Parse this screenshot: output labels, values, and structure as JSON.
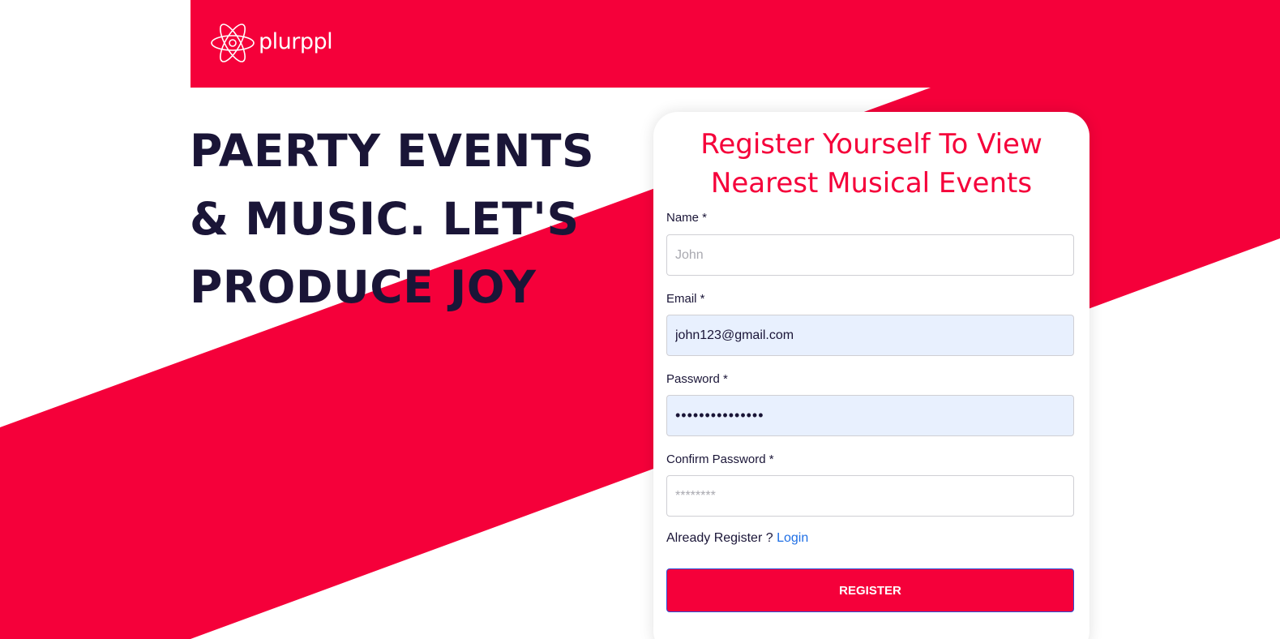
{
  "brand": {
    "name": "plurppl",
    "logo_icon": "atom-icon",
    "accent": "#f5003a",
    "dark": "#1a1537",
    "link": "#1f6fe5"
  },
  "hero": {
    "headline": "PAERTY EVENTS\n& MUSIC. LET'S\nPRODUCE JOY"
  },
  "form": {
    "title": "Register Yourself To View\nNearest Musical Events",
    "name": {
      "label": "Name *",
      "placeholder": "John",
      "value": ""
    },
    "email": {
      "label": "Email *",
      "placeholder": "",
      "value": "john123@gmail.com"
    },
    "password": {
      "label": "Password *",
      "value": "•••••••••••••••"
    },
    "confirm_password": {
      "label": "Confirm Password *",
      "placeholder": "********",
      "value": ""
    },
    "login_prompt": "Already Register ?",
    "login_link": "Login",
    "submit_label": "REGISTER"
  }
}
